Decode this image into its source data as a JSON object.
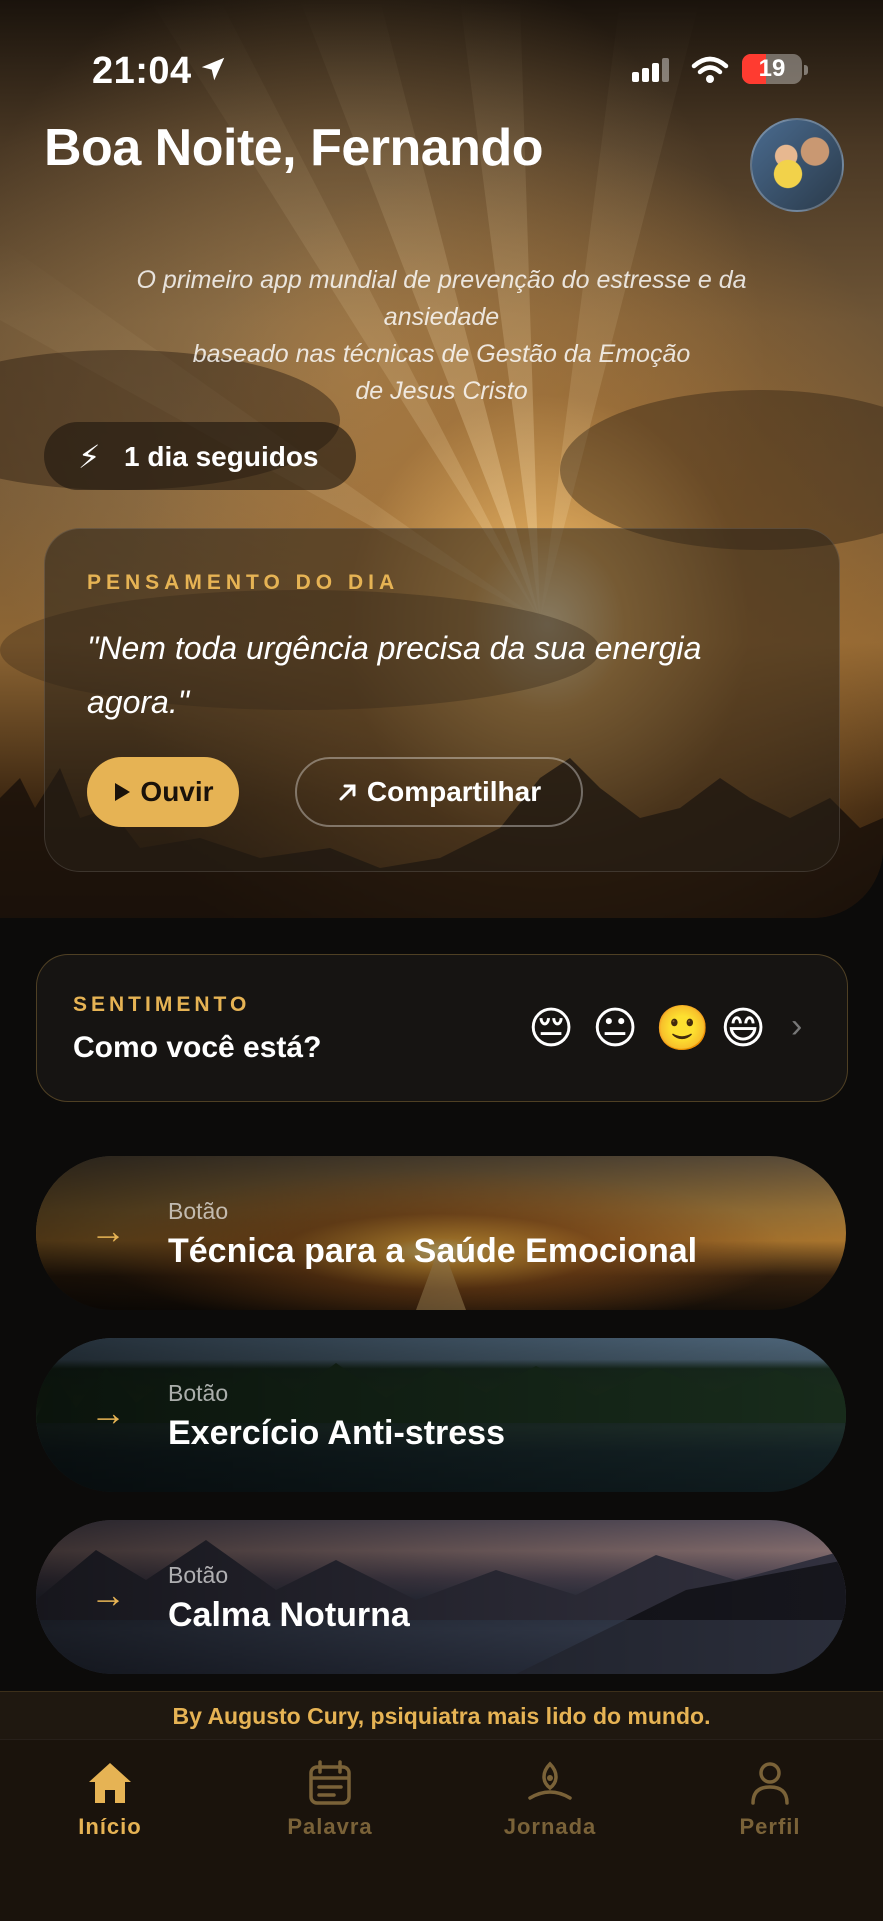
{
  "status_bar": {
    "time": "21:04",
    "battery": "19"
  },
  "header": {
    "greeting": "Boa Noite, Fernando"
  },
  "tagline": [
    "O primeiro app mundial de prevenção do estresse e da",
    "ansiedade",
    "baseado nas técnicas de Gestão da Emoção",
    "de Jesus Cristo"
  ],
  "streak": {
    "icon": "⚡",
    "label": "1 dia seguidos"
  },
  "thought": {
    "label": "PENSAMENTO DO DIA",
    "quote": "\"Nem toda urgência precisa da sua energia agora.\"",
    "listen_label": "Ouvir",
    "share_label": "Compartilhar"
  },
  "mood": {
    "label": "SENTIMENTO",
    "question": "Como você está?",
    "emojis": [
      "😔",
      "😐",
      "🙂",
      "😄"
    ]
  },
  "actions": [
    {
      "sub": "Botão",
      "title": "Técnica para a Saúde Emocional"
    },
    {
      "sub": "Botão",
      "title": "Exercício Anti-stress"
    },
    {
      "sub": "Botão",
      "title": "Calma Noturna"
    }
  ],
  "footer": {
    "credit": "By Augusto Cury, psiquiatra mais lido do mundo."
  },
  "tabs": [
    {
      "label": "Início",
      "icon": "home-icon",
      "active": true
    },
    {
      "label": "Palavra",
      "icon": "calendar-icon",
      "active": false
    },
    {
      "label": "Jornada",
      "icon": "meditation-icon",
      "active": false
    },
    {
      "label": "Perfil",
      "icon": "person-icon",
      "active": false
    }
  ],
  "colors": {
    "accent": "#e6b354",
    "background": "#0c0b0a",
    "tab_inactive": "#7a6238",
    "battery_low": "#ff3b30"
  }
}
